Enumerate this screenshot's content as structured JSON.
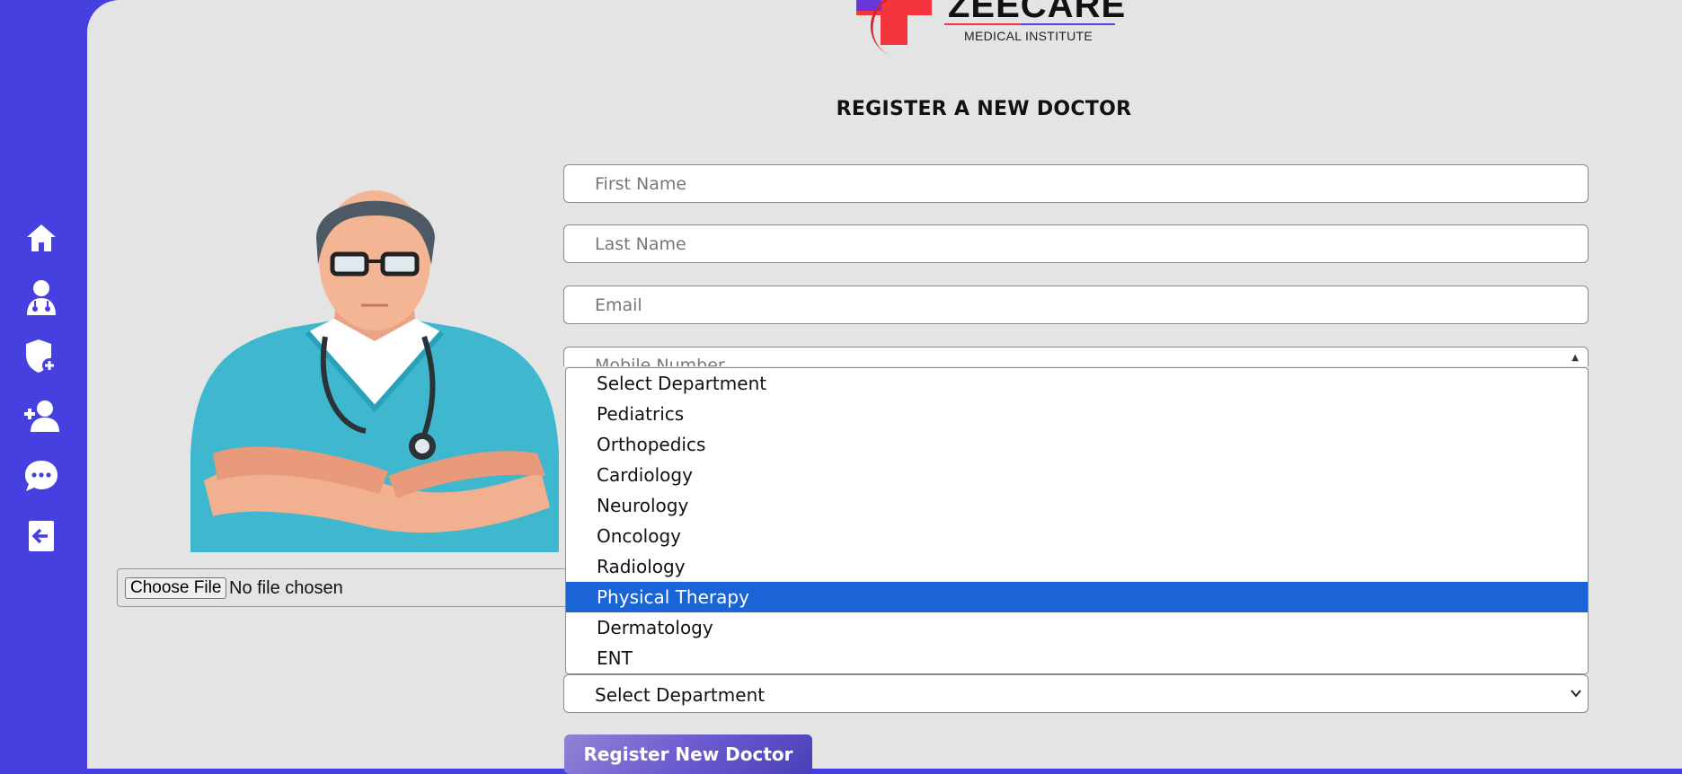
{
  "logo": {
    "name": "ZEECARE",
    "subtitle": "MEDICAL INSTITUTE"
  },
  "page_title": "REGISTER A NEW DOCTOR",
  "sidebar": {
    "icons": [
      "home-icon",
      "doctor-icon",
      "add-admin-shield-icon",
      "add-user-icon",
      "messages-icon",
      "logout-icon"
    ]
  },
  "file_input": {
    "button_label": "Choose File",
    "status": "No file chosen"
  },
  "form": {
    "first_name_placeholder": "First Name",
    "last_name_placeholder": "Last Name",
    "email_placeholder": "Email",
    "mobile_placeholder": "Mobile Number",
    "department_selected": "Select Department",
    "submit_label": "Register New Doctor"
  },
  "department_options": [
    "Select Department",
    "Pediatrics",
    "Orthopedics",
    "Cardiology",
    "Neurology",
    "Oncology",
    "Radiology",
    "Physical Therapy",
    "Dermatology",
    "ENT"
  ],
  "highlighted_option": "Physical Therapy",
  "colors": {
    "sidebar": "#4540df",
    "background": "#e4e4e4",
    "highlight": "#1a64d6",
    "logo_red": "#f3353e"
  }
}
